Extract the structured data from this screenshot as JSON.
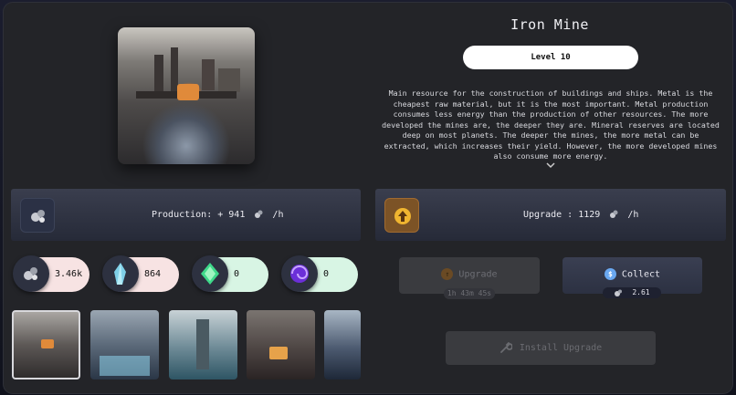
{
  "building": {
    "title": "Iron Mine",
    "level_label": "Level 10",
    "description": "Main resource for the construction of buildings and ships. Metal is the cheapest raw material, but it is the most important. Metal production consumes less energy than the production of other resources. The more developed the mines are, the deeper they are. Mineral reserves are located deep on most planets. The deeper the mines, the more metal can be extracted, which increases their yield. However, the more developed mines also consume more energy.",
    "expand_icon": "chevron-down-icon"
  },
  "production": {
    "label": "Production: + 941",
    "unit": "/h",
    "icon": "metal-ore-icon"
  },
  "upgrade_info": {
    "label": "Upgrade : 1129",
    "unit": "/h",
    "icon": "upgrade-arrow-icon"
  },
  "resources": [
    {
      "name": "metal",
      "value": "3.46k",
      "icon": "metal-ore-icon",
      "color": "#f8e3e3"
    },
    {
      "name": "crystal",
      "value": "864",
      "icon": "crystal-icon",
      "color": "#f8e3e3"
    },
    {
      "name": "deuterium",
      "value": "0",
      "icon": "green-gem-icon",
      "color": "#d8f5e4"
    },
    {
      "name": "dark-matter",
      "value": "0",
      "icon": "purple-vortex-icon",
      "color": "#d8f5e4"
    }
  ],
  "actions": {
    "upgrade_label": "Upgrade",
    "upgrade_timer": "1h 43m 45s",
    "collect_label": "Collect",
    "collect_amount": "2.61",
    "install_label": "Install Upgrade"
  },
  "thumbnails": [
    "iron-mine",
    "crystal-mine",
    "deuterium-tower",
    "solar-plant",
    "factory"
  ],
  "colors": {
    "panel": "#232428",
    "bar": "#2f3344",
    "upgrade_icon_bg": "#8a5a2a",
    "selected_border": "#d8d8dc"
  }
}
